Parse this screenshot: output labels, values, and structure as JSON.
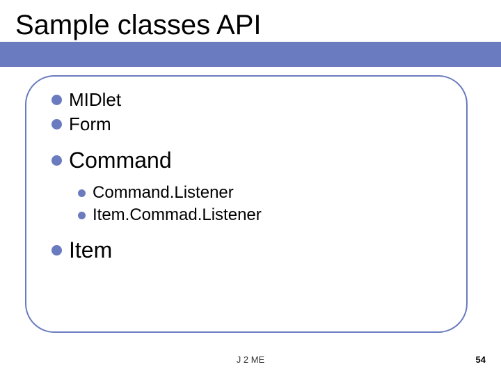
{
  "title": "Sample classes API",
  "bullets": {
    "midlet": "MIDlet",
    "form": "Form",
    "command": "Command",
    "commandListener": "Command.Listener",
    "itemCommadListener": "Item.Commad.Listener",
    "item": "Item"
  },
  "footer": {
    "center": "J 2 ME",
    "page": "54"
  }
}
